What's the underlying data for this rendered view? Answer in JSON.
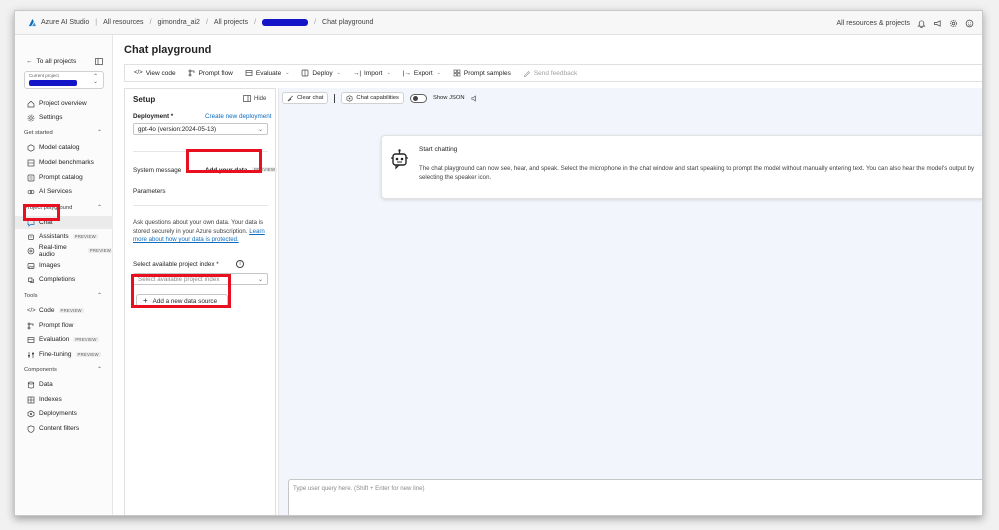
{
  "topbar": {
    "app_name": "Azure AI Studio",
    "breadcrumbs": [
      "All resources",
      "gimondra_ai2",
      "All projects",
      "Chat playground"
    ],
    "right_label": "All resources & projects"
  },
  "leftnav": {
    "back_label": "To all projects",
    "current_project_label": "Current project",
    "top_items": [
      {
        "label": "Project overview",
        "icon": "home-icon"
      },
      {
        "label": "Settings",
        "icon": "gear-icon"
      }
    ],
    "sections": [
      {
        "title": "Get started",
        "items": [
          {
            "label": "Model catalog",
            "icon": "cube-icon"
          },
          {
            "label": "Model benchmarks",
            "icon": "benchmark-icon"
          },
          {
            "label": "Prompt catalog",
            "icon": "catalog-icon"
          },
          {
            "label": "AI Services",
            "icon": "services-icon"
          }
        ]
      },
      {
        "title": "Project playground",
        "items": [
          {
            "label": "Chat",
            "icon": "chat-icon",
            "selected": true
          },
          {
            "label": "Assistants",
            "icon": "assistant-icon",
            "preview": "PREVIEW"
          },
          {
            "label": "Real-time audio",
            "icon": "audio-icon",
            "preview": "PREVIEW"
          },
          {
            "label": "Images",
            "icon": "image-icon"
          },
          {
            "label": "Completions",
            "icon": "completions-icon"
          }
        ]
      },
      {
        "title": "Tools",
        "items": [
          {
            "label": "Code",
            "icon": "code-icon",
            "preview": "PREVIEW"
          },
          {
            "label": "Prompt flow",
            "icon": "flow-icon"
          },
          {
            "label": "Evaluation",
            "icon": "evaluation-icon",
            "preview": "PREVIEW"
          },
          {
            "label": "Fine-tuning",
            "icon": "tuning-icon",
            "preview": "PREVIEW"
          }
        ]
      },
      {
        "title": "Components",
        "items": [
          {
            "label": "Data",
            "icon": "data-icon"
          },
          {
            "label": "Indexes",
            "icon": "index-icon"
          },
          {
            "label": "Deployments",
            "icon": "deployments-icon"
          },
          {
            "label": "Content filters",
            "icon": "shield-icon"
          }
        ]
      }
    ]
  },
  "page": {
    "title": "Chat playground",
    "toolbar": [
      {
        "label": "View code",
        "icon": "code-icon"
      },
      {
        "label": "Prompt flow",
        "icon": "flow-icon"
      },
      {
        "label": "Evaluate",
        "icon": "evaluate-icon",
        "dropdown": true
      },
      {
        "label": "Deploy",
        "icon": "deploy-icon",
        "dropdown": true
      },
      {
        "label": "Import",
        "icon": "import-icon",
        "dropdown": true
      },
      {
        "label": "Export",
        "icon": "export-icon",
        "dropdown": true
      },
      {
        "label": "Prompt samples",
        "icon": "samples-icon"
      },
      {
        "label": "Send feedback",
        "icon": "feedback-icon",
        "disabled": true
      }
    ]
  },
  "setup": {
    "title": "Setup",
    "hide_label": "Hide",
    "deployment_label": "Deployment *",
    "create_deployment_link": "Create new deployment",
    "deployment_value": "gpt-4o (version:2024-05-13)",
    "system_message_tab": "System message",
    "add_your_data_tab": "Add your data",
    "add_your_data_preview": "PREVIEW",
    "parameters_tab": "Parameters",
    "description": "Ask questions about your own data. Your data is stored securely in your Azure subscription.",
    "learn_more_link": "Learn more about how your data is protected.",
    "index_label": "Select available project index *",
    "index_placeholder": "Select available project index",
    "add_source_button": "Add a new data source"
  },
  "chat": {
    "clear_chat": "Clear chat",
    "chat_capabilities": "Chat capabilities",
    "show_json": "Show JSON",
    "show_json_on": false,
    "start_title": "Start chatting",
    "start_body": "The chat playground can now see, hear, and speak. Select the microphone in the chat window and start speaking to prompt the model without manually entering text. You can also hear the model's output by selecting the speaker icon.",
    "input_placeholder": "Type user query here. (Shift + Enter for new line)"
  },
  "colors": {
    "highlight": "#e8101f",
    "link": "#0f6cbd",
    "chat_bg": "#f2f5fb",
    "redaction": "#1515c8"
  }
}
